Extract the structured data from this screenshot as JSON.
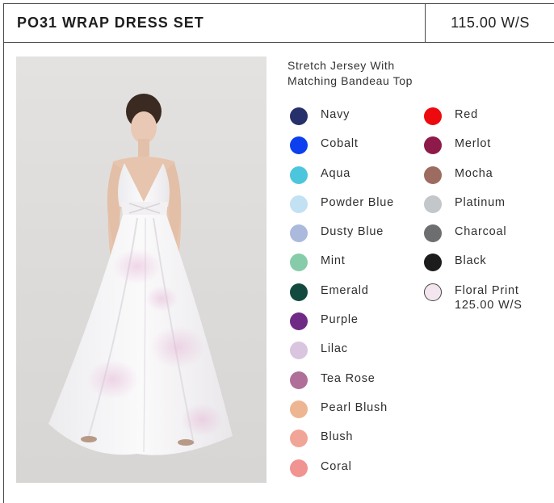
{
  "header": {
    "title": "PO31 WRAP DRESS SET",
    "price": "115.00 W/S"
  },
  "description": {
    "line1": "Stretch Jersey With",
    "line2": "Matching Bandeau Top"
  },
  "colors_left": [
    {
      "name": "Navy",
      "hex": "#26306a"
    },
    {
      "name": "Cobalt",
      "hex": "#0b3ff0"
    },
    {
      "name": "Aqua",
      "hex": "#4cc6dd"
    },
    {
      "name": "Powder Blue",
      "hex": "#c2e1f3"
    },
    {
      "name": "Dusty Blue",
      "hex": "#aab9dc"
    },
    {
      "name": "Mint",
      "hex": "#86ccaa"
    },
    {
      "name": "Emerald",
      "hex": "#134a40"
    },
    {
      "name": "Purple",
      "hex": "#6f2a86"
    },
    {
      "name": "Lilac",
      "hex": "#d9c5df"
    },
    {
      "name": "Tea Rose",
      "hex": "#b06f99"
    },
    {
      "name": "Pearl Blush",
      "hex": "#edb591"
    },
    {
      "name": "Blush",
      "hex": "#f1a596"
    },
    {
      "name": "Coral",
      "hex": "#f19391"
    }
  ],
  "colors_right": [
    {
      "name": "Red",
      "hex": "#ec0a0e"
    },
    {
      "name": "Merlot",
      "hex": "#8e1a4a"
    },
    {
      "name": "Mocha",
      "hex": "#9c6c60"
    },
    {
      "name": "Platinum",
      "hex": "#c3c7ca"
    },
    {
      "name": "Charcoal",
      "hex": "#6d6e70"
    },
    {
      "name": "Black",
      "hex": "#1c1c1c"
    },
    {
      "name": "Floral Print",
      "hex": "#f4e6ee",
      "price": "125.00 W/S"
    }
  ]
}
